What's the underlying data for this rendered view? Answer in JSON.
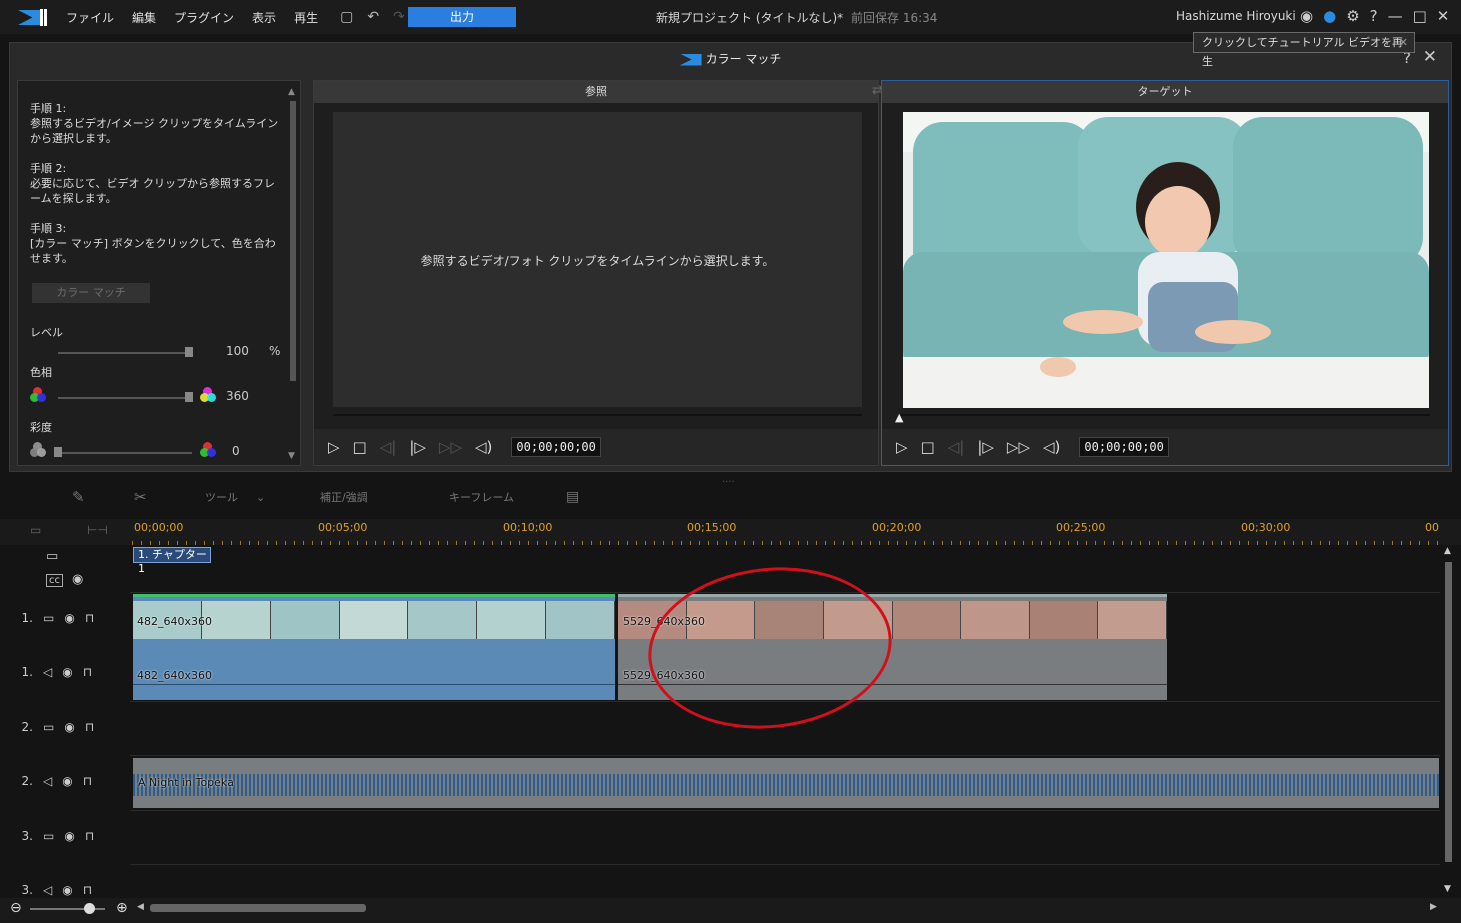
{
  "menubar": {
    "menus": [
      "ファイル",
      "編集",
      "プラグイン",
      "表示",
      "再生"
    ],
    "output_label": "出力",
    "project_title": "新規プロジェクト (タイトルなし)*",
    "saved_label": "前回保存 16:34",
    "user_name": "Hashizume Hiroyuki"
  },
  "color_match": {
    "title": "カラー マッチ",
    "help": "?",
    "tooltip": "クリックしてチュートリアル ビデオを再生",
    "steps": [
      {
        "head": "手順 1:",
        "text": "参照するビデオ/イメージ クリップをタイムラインから選択します。"
      },
      {
        "head": "手順 2:",
        "text": "必要に応じて、ビデオ クリップから参照するフレームを探します。"
      },
      {
        "head": "手順 3:",
        "text": "[カラー マッチ] ボタンをクリックして、色を合わせます。"
      }
    ],
    "match_button": "カラー マッチ",
    "level_label": "レベル",
    "level_value": "100",
    "level_unit": "%",
    "hue_label": "色相",
    "hue_value": "360",
    "saturation_label": "彩度",
    "saturation_value": "0",
    "reference_title": "参照",
    "reference_message": "参照するビデオ/フォト クリップをタイムラインから選択します。",
    "target_title": "ターゲット",
    "ref_timecode": "00;00;00;00",
    "target_timecode": "00;00;00;00"
  },
  "toolbar": {
    "tools_label": "ツール",
    "correction_label": "補正/強調",
    "keyframe_label": "キーフレーム"
  },
  "timeline": {
    "ruler": [
      "00;00;00",
      "00;05;00",
      "00;10;00",
      "00;15;00",
      "00;20;00",
      "00;25;00",
      "00;30;00",
      "00"
    ],
    "chapter": "1. チャプター 1",
    "tracks": [
      "1.",
      "1.",
      "2.",
      "2.",
      "3.",
      "3."
    ],
    "clips": {
      "video1": "482_640x360",
      "audio1": "482_640x360",
      "video2": "5529_640x360",
      "audio2": "5529_640x360",
      "music": "A Night in Topeka"
    }
  },
  "colors": {
    "accent": "#2a7ee0",
    "clip_blue": "#5a8ab5",
    "clip_gray": "#7a7d80",
    "ruler": "#e0a020",
    "annotation": "#d0101c"
  }
}
